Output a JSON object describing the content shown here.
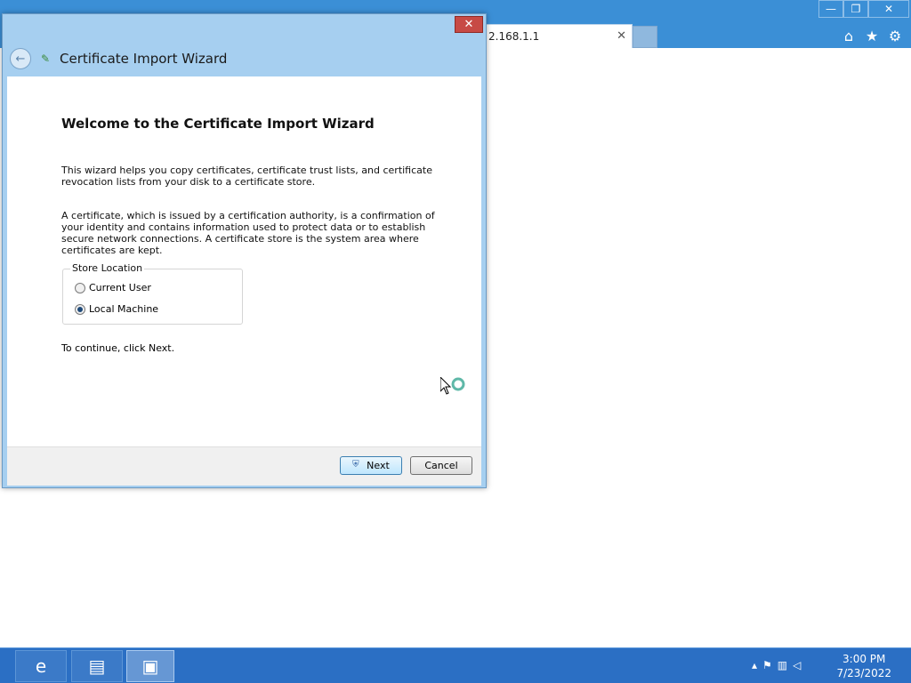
{
  "browser": {
    "tab_label": "2.168.1.1",
    "tab_close": "✕",
    "window_controls": {
      "minimize": "—",
      "restore": "❐",
      "close": "✕"
    },
    "nav_icons": [
      "home-icon",
      "star-icon",
      "gear-icon"
    ]
  },
  "dialog": {
    "title": "Certificate Import Wizard",
    "close_glyph": "✕",
    "heading": "Welcome to the Certificate Import Wizard",
    "para1": "This wizard helps you copy certificates, certificate trust lists, and certificate revocation lists from your disk to a certificate store.",
    "para2": "A certificate, which is issued by a certification authority, is a confirmation of your identity and contains information used to protect data or to establish secure network connections. A certificate store is the system area where certificates are kept.",
    "store_location": {
      "legend": "Store Location",
      "options": [
        {
          "label": "Current User",
          "checked": false
        },
        {
          "label": "Local Machine",
          "checked": true
        }
      ]
    },
    "continue_text": "To continue, click Next.",
    "buttons": {
      "next": "Next",
      "cancel": "Cancel"
    }
  },
  "taskbar": {
    "apps": [
      "internet-explorer-icon",
      "file-explorer-icon",
      "certificate-wizard-icon"
    ],
    "clock": {
      "time": "3:00 PM",
      "date": "7/23/2022"
    }
  },
  "colors": {
    "titlebar": "#3b8fd6",
    "dialog_frame": "#a6cff0",
    "taskbar": "#2b6fc4",
    "close_button": "#c74a45"
  }
}
